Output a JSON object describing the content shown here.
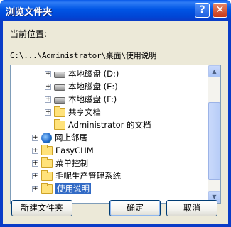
{
  "window": {
    "title": "浏览文件夹",
    "help_glyph": "?",
    "close_glyph": "✕"
  },
  "prompt_label": "当前位置:",
  "current_path": "C:\\...\\Administrator\\桌面\\使用说明",
  "tree": {
    "items": [
      {
        "label": "本地磁盘 (D:)",
        "icon": "disk-icon",
        "expandable": true
      },
      {
        "label": "本地磁盘 (E:)",
        "icon": "disk-icon",
        "expandable": true
      },
      {
        "label": "本地磁盘 (F:)",
        "icon": "disk-icon",
        "expandable": true
      },
      {
        "label": "共享文档",
        "icon": "folder-icon",
        "expandable": true
      },
      {
        "label": "Administrator 的文档",
        "icon": "folder-icon",
        "expandable": false
      },
      {
        "label": "网上邻居",
        "icon": "network-icon",
        "expandable": true
      },
      {
        "label": "EasyCHM",
        "icon": "folder-icon",
        "expandable": true
      },
      {
        "label": "菜单控制",
        "icon": "folder-icon",
        "expandable": true
      },
      {
        "label": "毛呢生产管理系统",
        "icon": "folder-icon",
        "expandable": true
      },
      {
        "label": "使用说明",
        "icon": "folder-icon",
        "expandable": true,
        "selected": true
      }
    ],
    "expand_glyph": "+"
  },
  "scrollbar": {
    "up_glyph": "▲",
    "down_glyph": "▼"
  },
  "buttons": {
    "new_folder": "新建文件夹",
    "ok": "确定",
    "cancel": "取消"
  }
}
